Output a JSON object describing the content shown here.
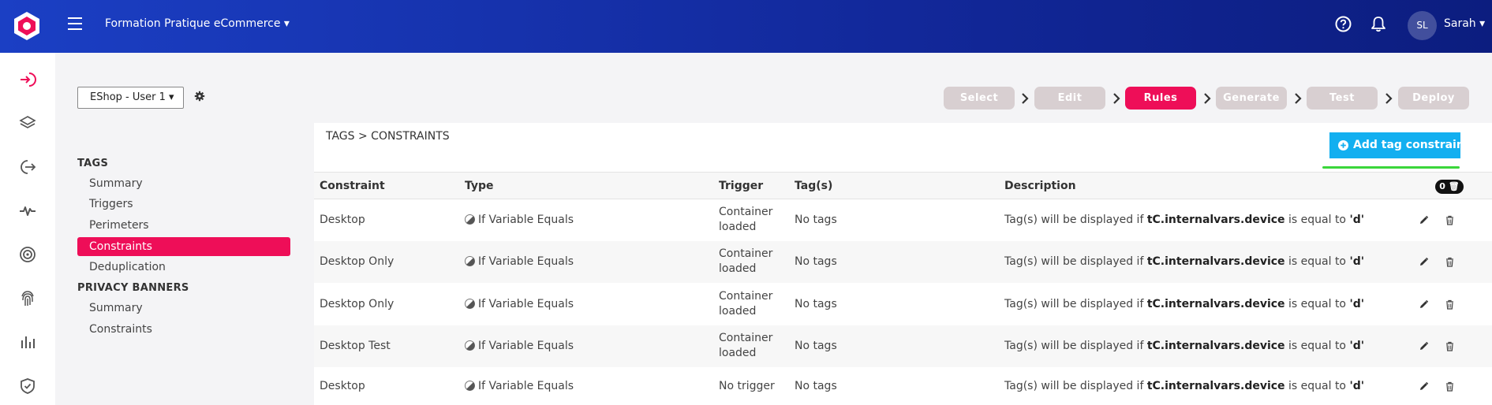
{
  "header": {
    "project": "Formation Pratique eCommerce",
    "avatar_initials": "SL",
    "user_name": "Sarah",
    "brand_color": "#ee0e58",
    "bar_color": "#12289a"
  },
  "sidebar": {
    "icons": [
      "sign-in-icon",
      "layers-icon",
      "sign-out-icon",
      "activity-icon",
      "target-icon",
      "fingerprint-icon",
      "bar-chart-icon",
      "shield-icon"
    ]
  },
  "toolbar": {
    "site_select": "EShop - User 1"
  },
  "steps": [
    "Select",
    "Edit",
    "Rules",
    "Generate",
    "Test",
    "Deploy"
  ],
  "active_step": "Rules",
  "nav": {
    "tags_heading": "TAGS",
    "tags_items": [
      "Summary",
      "Triggers",
      "Perimeters",
      "Constraints",
      "Deduplication"
    ],
    "privacy_heading": "PRIVACY BANNERS",
    "privacy_items": [
      "Summary",
      "Constraints"
    ]
  },
  "panel": {
    "breadcrumb": "TAGS > CONSTRAINTS",
    "add_button": "Add tag constraint",
    "columns": [
      "Constraint",
      "Type",
      "Trigger",
      "Tag(s)",
      "Description"
    ],
    "count_badge": "0",
    "rows": [
      {
        "constraint": "Desktop",
        "type": "If Variable Equals",
        "trigger_l1": "Container",
        "trigger_l2": "loaded",
        "tags": "No tags",
        "desc_pre": "Tag(s) will be displayed if ",
        "desc_var": "tC.internalvars.device",
        "desc_mid": " is equal to ",
        "desc_val": "'d'"
      },
      {
        "constraint": "Desktop Only",
        "type": "If Variable Equals",
        "trigger_l1": "Container",
        "trigger_l2": "loaded",
        "tags": "No tags",
        "desc_pre": "Tag(s) will be displayed if ",
        "desc_var": "tC.internalvars.device",
        "desc_mid": " is equal to ",
        "desc_val": "'d'"
      },
      {
        "constraint": "Desktop Only",
        "type": "If Variable Equals",
        "trigger_l1": "Container",
        "trigger_l2": "loaded",
        "tags": "No tags",
        "desc_pre": "Tag(s) will be displayed if ",
        "desc_var": "tC.internalvars.device",
        "desc_mid": " is equal to ",
        "desc_val": "'d'"
      },
      {
        "constraint": "Desktop Test",
        "type": "If Variable Equals",
        "trigger_l1": "Container",
        "trigger_l2": "loaded",
        "tags": "No tags",
        "desc_pre": "Tag(s) will be displayed if ",
        "desc_var": "tC.internalvars.device",
        "desc_mid": " is equal to ",
        "desc_val": "'d'"
      },
      {
        "constraint": "Desktop",
        "type": "If Variable Equals",
        "trigger_l1": "No trigger",
        "trigger_l2": "",
        "tags": "No tags",
        "desc_pre": "Tag(s) will be displayed if ",
        "desc_var": "tC.internalvars.device",
        "desc_mid": " is equal to ",
        "desc_val": "'d'"
      }
    ]
  }
}
